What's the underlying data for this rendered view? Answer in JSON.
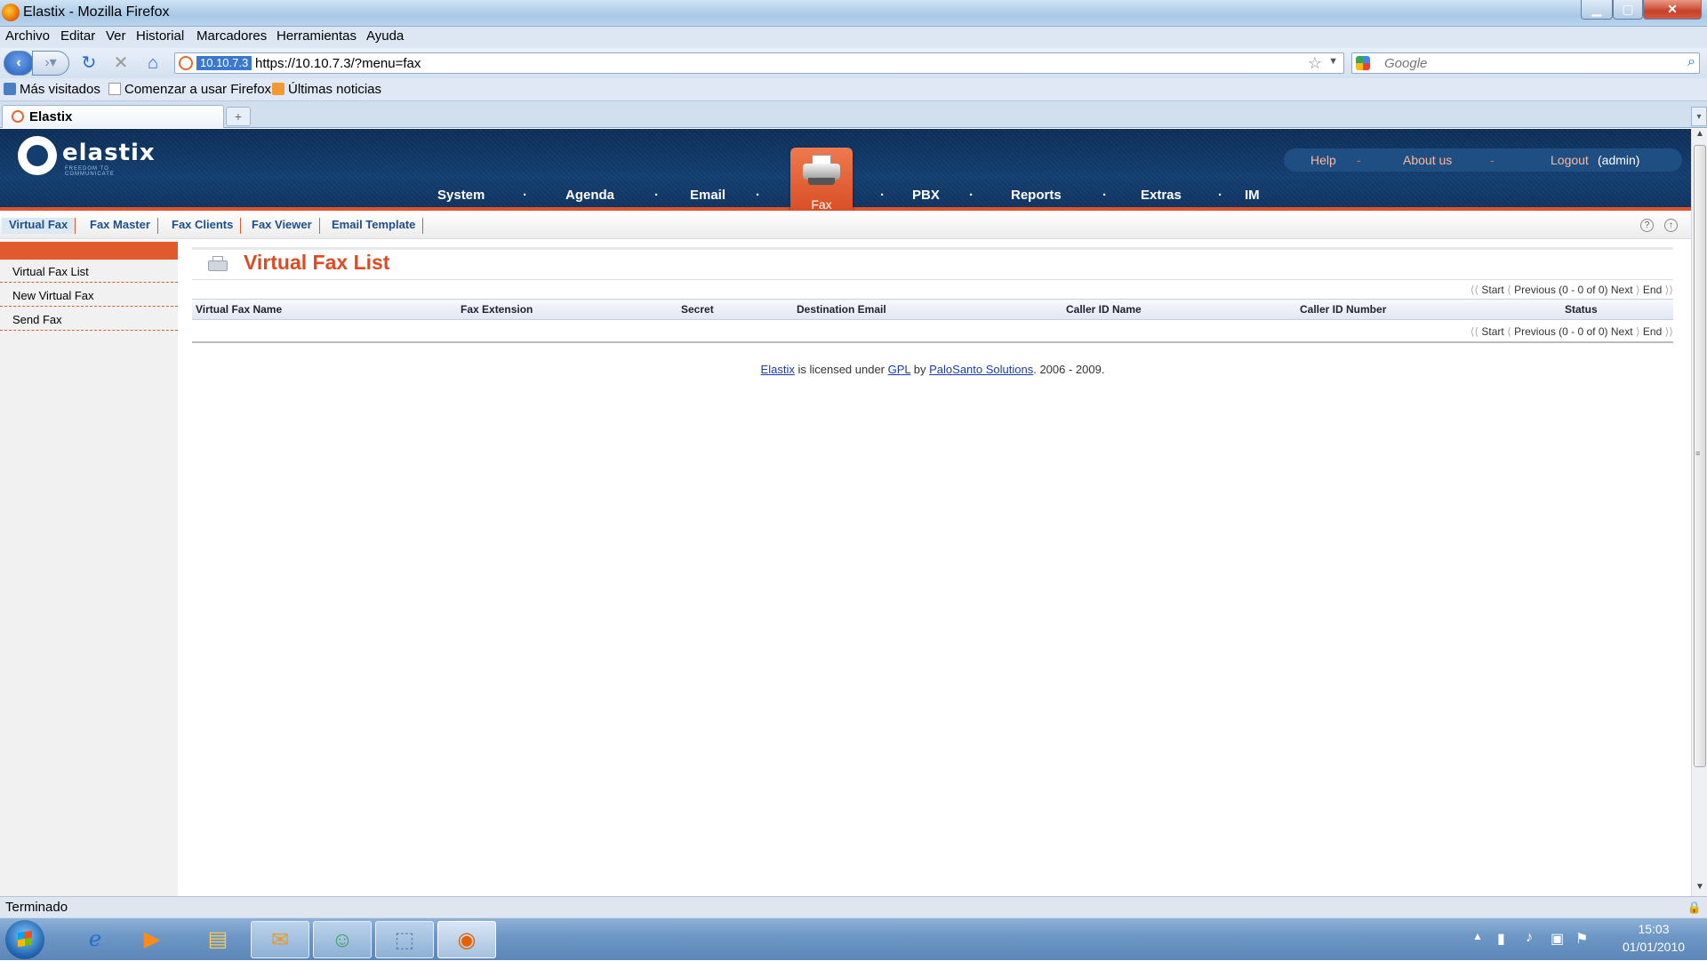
{
  "window": {
    "title": "Elastix - Mozilla Firefox",
    "min": "▁",
    "max": "▢",
    "close": "✕"
  },
  "menubar": [
    "Archivo",
    "Editar",
    "Ver",
    "Historial",
    "Marcadores",
    "Herramientas",
    "Ayuda"
  ],
  "navbar": {
    "site_chip": "10.10.7.3",
    "url": "https://10.10.7.3/?menu=fax",
    "search_placeholder": "Google",
    "icons": [
      "back-icon",
      "forward-icon",
      "reload-icon",
      "stop-icon",
      "home-icon",
      "bookmark-star-icon",
      "search-icon"
    ]
  },
  "bookmarks": [
    "Más visitados",
    "Comenzar a usar Firefox",
    "Últimas noticias"
  ],
  "tab": {
    "label": "Elastix",
    "new_tab": "+",
    "list": "▾"
  },
  "elastix": {
    "brand": "elastix",
    "tagline": "FREEDOM TO COMMUNICATE",
    "toplinks": {
      "help": "Help",
      "about": "About us",
      "logout": "Logout",
      "user": "(admin)",
      "sep": "-"
    },
    "mainnav": [
      "System",
      "Agenda",
      "Email",
      "Fax",
      "PBX",
      "Reports",
      "Extras",
      "IM"
    ],
    "dot": "·",
    "active_module": "Fax",
    "accent_color": "#e05a2e",
    "header_color": "#123d6e"
  },
  "submenu": {
    "tabs": [
      "Virtual Fax",
      "Fax Master",
      "Fax Clients",
      "Fax Viewer",
      "Email Template"
    ],
    "active": "Virtual Fax",
    "help": "?",
    "collapse": "↑"
  },
  "sidebar": {
    "items": [
      "Virtual Fax List",
      "New Virtual Fax",
      "Send Fax"
    ]
  },
  "content": {
    "title": "Virtual Fax List",
    "pager": {
      "start": "Start",
      "previous": "Previous",
      "range": "(0 - 0 of 0)",
      "next": "Next",
      "end": "End"
    },
    "columns": [
      "Virtual Fax Name",
      "Fax Extension",
      "Secret",
      "Destination Email",
      "Caller ID Name",
      "Caller ID Number",
      "Status"
    ],
    "rows": []
  },
  "footer": {
    "elastix": "Elastix",
    "t1": " is licensed under ",
    "gpl": "GPL",
    "t2": " by ",
    "palosanto": "PaloSanto Solutions",
    "t3": ". 2006 - 2009."
  },
  "statusbar": {
    "text": "Terminado"
  },
  "taskbar": {
    "time": "15:03",
    "date": "01/01/2010",
    "apps": [
      "internet-explorer-icon",
      "media-player-icon",
      "file-explorer-icon",
      "outlook-icon",
      "messenger-icon",
      "virtualbox-icon",
      "firefox-icon"
    ]
  }
}
